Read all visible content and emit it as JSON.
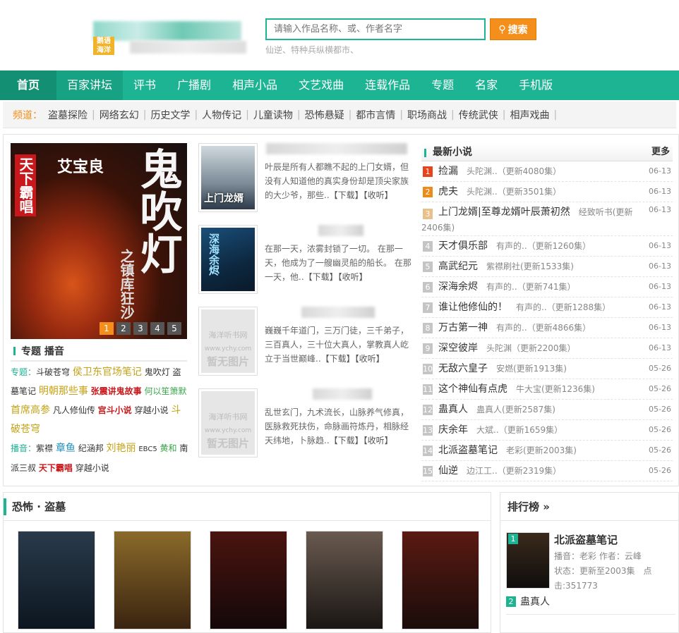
{
  "search": {
    "placeholder": "请输入作品名称、或、作者名字",
    "button": "搜索",
    "hot": "仙逆、特种兵纵横都市、"
  },
  "logo": {
    "mark_line1": "鹅语",
    "mark_line2": "海洋"
  },
  "nav": [
    "首页",
    "百家讲坛",
    "评书",
    "广播剧",
    "相声小品",
    "文艺戏曲",
    "连载作品",
    "专题",
    "名家",
    "手机版"
  ],
  "channel": {
    "label": "频道：",
    "items": [
      "盗墓探险",
      "网络玄幻",
      "历史文学",
      "人物传记",
      "儿童读物",
      "恐怖悬疑",
      "都市言情",
      "职场商战",
      "传统武侠",
      "相声戏曲"
    ]
  },
  "banner": {
    "title": "鬼吹灯",
    "subtitle": "之镇库狂沙",
    "author": "艾宝良",
    "tag": "天下霸唱",
    "pages": [
      "1",
      "2",
      "3",
      "4",
      "5"
    ],
    "active_page": 1
  },
  "topic": {
    "heading": "专题 播音",
    "k1": "专题：",
    "t1": "斗破苍穹",
    "t2": "侯卫东官场笔记",
    "t3": "鬼吹灯",
    "t4": "盗墓笔记",
    "t5": "明朝那些事",
    "t6": "张震讲鬼故事",
    "t7": "何以笙箫默",
    "t8": "首席高参",
    "t9": "凡人修仙传",
    "t10": "宫斗小说",
    "t11": "穿越小说",
    "t12": "斗破苍穹",
    "k2": "播音：",
    "b1": "紫襟",
    "b2": "章鱼",
    "b3": "纪涵邦",
    "b4": "刘艳丽",
    "b5": "EBC5",
    "b6": "黄和",
    "b7": "南派三叔",
    "b8": "天下霸唱",
    "b9": "穿越小说"
  },
  "books": [
    {
      "cover_text": "上门龙婿",
      "desc": "叶辰是所有人都瞧不起的上门女婿，但没有人知道他的真实身份却是顶尖家族的大少爷，那些..",
      "download": "【下载】",
      "fav": "【收听】"
    },
    {
      "cover_text": "深海余烬",
      "desc": "在那一天，浓雾封锁了一切。 在那一天，他成为了一艘幽灵船的船长。 在那一天，他..",
      "download": "【下载】",
      "fav": "【收听】"
    },
    {
      "cover_text": "暂无图片",
      "cover_site": "海洋听书网",
      "cover_url": "www.ychy.com",
      "desc": "巍巍千年道门，三万门徒，三千弟子，三百真人，三十位大真人，掌教真人屹立于当世巅峰..",
      "download": "【下载】",
      "fav": "【收听】"
    },
    {
      "cover_text": "暂无图片",
      "cover_site": "海洋听书网",
      "cover_url": "www.ychy.com",
      "desc": "乱世玄门，九术流长，山脉养气修真，医脉救死扶伤，命脉画符炼丹，相脉经天纬地，卜脉趋..",
      "download": "【下载】",
      "fav": "【收听】"
    }
  ],
  "latest": {
    "title": "最新小说",
    "more": "更多",
    "rows": [
      {
        "n": "1",
        "name": "捡漏",
        "meta": "头陀渊..（更新4080集）",
        "date": "06-13"
      },
      {
        "n": "2",
        "name": "虎夫",
        "meta": "头陀渊..（更新3501集）",
        "date": "06-13"
      },
      {
        "n": "3",
        "name": "上门龙婿|至尊龙婿叶辰萧初然",
        "meta": "经致听书(更新2406集)",
        "date": "06-13"
      },
      {
        "n": "4",
        "name": "天才俱乐部",
        "meta": "有声的..（更新1260集）",
        "date": "06-13"
      },
      {
        "n": "5",
        "name": "高武纪元",
        "meta": "紫襟刷社(更新1533集)",
        "date": "06-13"
      },
      {
        "n": "6",
        "name": "深海余烬",
        "meta": "有声的..（更新741集）",
        "date": "06-13"
      },
      {
        "n": "7",
        "name": "谁让他修仙的！",
        "meta": "有声的..（更新1288集）",
        "date": "06-13"
      },
      {
        "n": "8",
        "name": "万古第一神",
        "meta": "有声的..（更新4866集）",
        "date": "06-13"
      },
      {
        "n": "9",
        "name": "深空彼岸",
        "meta": "头陀渊（更新2200集）",
        "date": "06-13"
      },
      {
        "n": "10",
        "name": "无敌六皇子",
        "meta": "安燃(更新1913集)",
        "date": "05-26"
      },
      {
        "n": "11",
        "name": "这个神仙有点虎",
        "meta": "牛大宝(更新1236集)",
        "date": "05-26"
      },
      {
        "n": "12",
        "name": "蛊真人",
        "meta": "蛊真人(更新2587集)",
        "date": "05-26"
      },
      {
        "n": "13",
        "name": "庆余年",
        "meta": "大斌..（更新1659集）",
        "date": "05-26"
      },
      {
        "n": "14",
        "name": "北派盗墓笔记",
        "meta": "老彩(更新2003集)",
        "date": "05-26"
      },
      {
        "n": "15",
        "name": "仙逆",
        "meta": "边江工..（更新2319集）",
        "date": "05-26"
      }
    ]
  },
  "horror": {
    "title": "恐怖 · 盗墓"
  },
  "rank": {
    "title": "排行榜 »",
    "first": {
      "n": "1",
      "name": "北派盗墓笔记",
      "line1": "播音：老彩  作者：云峰",
      "line2": "状态：更新至2003集　点击:351773"
    },
    "second": {
      "n": "2",
      "name": "蛊真人"
    }
  }
}
